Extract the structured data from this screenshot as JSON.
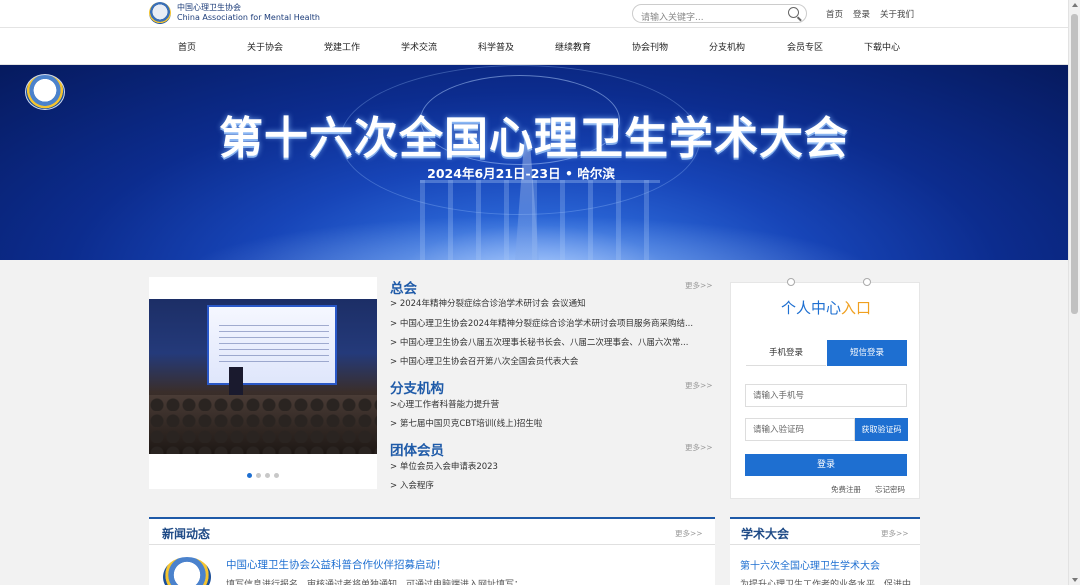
{
  "header": {
    "logo_cn": "中国心理卫生协会",
    "logo_en": "China Association for Mental Health",
    "search_placeholder": "请输入关键字...",
    "links": [
      "首页",
      "登录",
      "关于我们"
    ]
  },
  "nav": [
    "首页",
    "关于协会",
    "党建工作",
    "学术交流",
    "科学普及",
    "继续教育",
    "协会刊物",
    "分支机构",
    "会员专区",
    "下载中心"
  ],
  "banner": {
    "title": "第十六次全国心理卫生学术大会",
    "date": "2024年6月21日-23日 • 哈尔滨"
  },
  "slideshow": {
    "dots": 4,
    "active": 0
  },
  "sections": {
    "more": "更多>>",
    "zonghui": {
      "title": "总会",
      "items": [
        "> 2024年精神分裂症综合诊治学术研讨会 会议通知",
        "> 中国心理卫生协会2024年精神分裂症综合诊治学术研讨会项目服务商采购结...",
        "> 中国心理卫生协会八届五次理事长秘书长会、八届二次理事会、八届六次常...",
        "> 中国心理卫生协会召开第八次全国会员代表大会"
      ]
    },
    "branch": {
      "title": "分支机构",
      "items": [
        ">心理工作者科普能力提升营",
        "> 第七届中国贝克CBT培训(线上)招生啦"
      ]
    },
    "group": {
      "title": "团体会员",
      "items": [
        "> 单位会员入会申请表2023",
        "> 入会程序"
      ]
    }
  },
  "personal_center": {
    "title_part1": "个人中心",
    "title_part2": "入口",
    "tab_phone": "手机登录",
    "tab_sms": "短信登录",
    "phone_placeholder": "请输入手机号",
    "code_placeholder": "请输入验证码",
    "get_code": "获取验证码",
    "login": "登录",
    "register": "免费注册",
    "forgot": "忘记密码"
  },
  "news": {
    "title": "新闻动态",
    "more": "更多>>",
    "feature_title": "中国心理卫生协会公益科普合作伙伴招募启动！",
    "feature_snippet": "填写信息进行报名，审核通过者将单独通知，可通过电脑端进入网址填写："
  },
  "conference": {
    "title": "学术大会",
    "more": "更多>>",
    "item_title": "第十六次全国心理卫生学术大会",
    "item_snippet": "为提升心理卫生工作者的业务水平，促进中"
  },
  "colors": {
    "brand_blue": "#1e6fd1",
    "heading_blue": "#1e5aa8",
    "accent_orange": "#f0a020"
  }
}
